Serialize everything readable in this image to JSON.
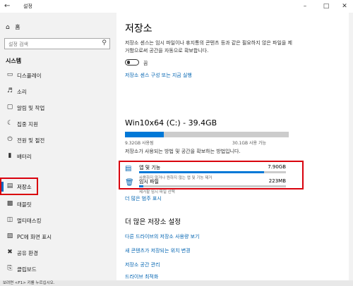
{
  "window": {
    "title": "설정",
    "back_icon": "back-arrow-icon",
    "min_icon": "minimize-icon",
    "max_icon": "maximize-icon",
    "close_icon": "close-icon"
  },
  "sidebar": {
    "home_label": "홈",
    "search_placeholder": "설정 검색",
    "section_title": "시스템",
    "items": [
      {
        "label": "디스플레이",
        "icon": "display-icon"
      },
      {
        "label": "소리",
        "icon": "sound-icon"
      },
      {
        "label": "알림 및 작업",
        "icon": "notification-icon"
      },
      {
        "label": "집중 지원",
        "icon": "focus-assist-icon"
      },
      {
        "label": "전원 및 절전",
        "icon": "power-icon"
      },
      {
        "label": "배터리",
        "icon": "battery-icon"
      },
      {
        "label": "저장소",
        "icon": "storage-icon"
      },
      {
        "label": "태블릿",
        "icon": "tablet-icon"
      },
      {
        "label": "멀티태스킹",
        "icon": "multitasking-icon"
      },
      {
        "label": "PC에 화면 표시",
        "icon": "project-icon"
      },
      {
        "label": "공유 환경",
        "icon": "shared-experience-icon"
      },
      {
        "label": "클립보드",
        "icon": "clipboard-icon"
      }
    ],
    "selected": "저장소"
  },
  "main": {
    "title": "저장소",
    "description": "저장소 센스는 임시 파일이나 휴지통의 콘텐츠 등과 같은 필요하지 않은 파일을 제거함으로써 공간을 자동으로 확보합니다.",
    "toggle_label": "끔",
    "toggle_on": false,
    "sense_link": "저장소 센스 구성 또는 지금 실행",
    "drive_title": "Win10x64 (C:) - 39.4GB",
    "drive_used_fraction": 0.236,
    "drive_used": "9.32GB 사용됨",
    "drive_free": "30.1GB 사용 가능",
    "drive_info": "저장소가 사용되는 방법 및 공간을 확보하는 방법입니다.",
    "categories": [
      {
        "name": "앱 및 기능",
        "size": "7.90GB",
        "sub": "사용하지 않거나 원하지 않는 앱 및 기능 제거",
        "fill": 0.85,
        "icon": "apps-icon"
      },
      {
        "name": "임시 파일",
        "size": "223MB",
        "sub": "제거할 임시 파일 선택",
        "fill": 0.03,
        "icon": "trash-icon"
      }
    ],
    "more_categories_link": "더 많은 범주 표시",
    "more_settings_title": "더 많은 저장소 설정",
    "links": [
      "다른 드라이브의 저장소 사용량 보기",
      "새 콘텐츠가 저장되는 위치 변경",
      "저장소 공간 관리",
      "드라이브 최적화"
    ]
  },
  "status_bar": "보려면 <F1> 키를 누르십시오."
}
